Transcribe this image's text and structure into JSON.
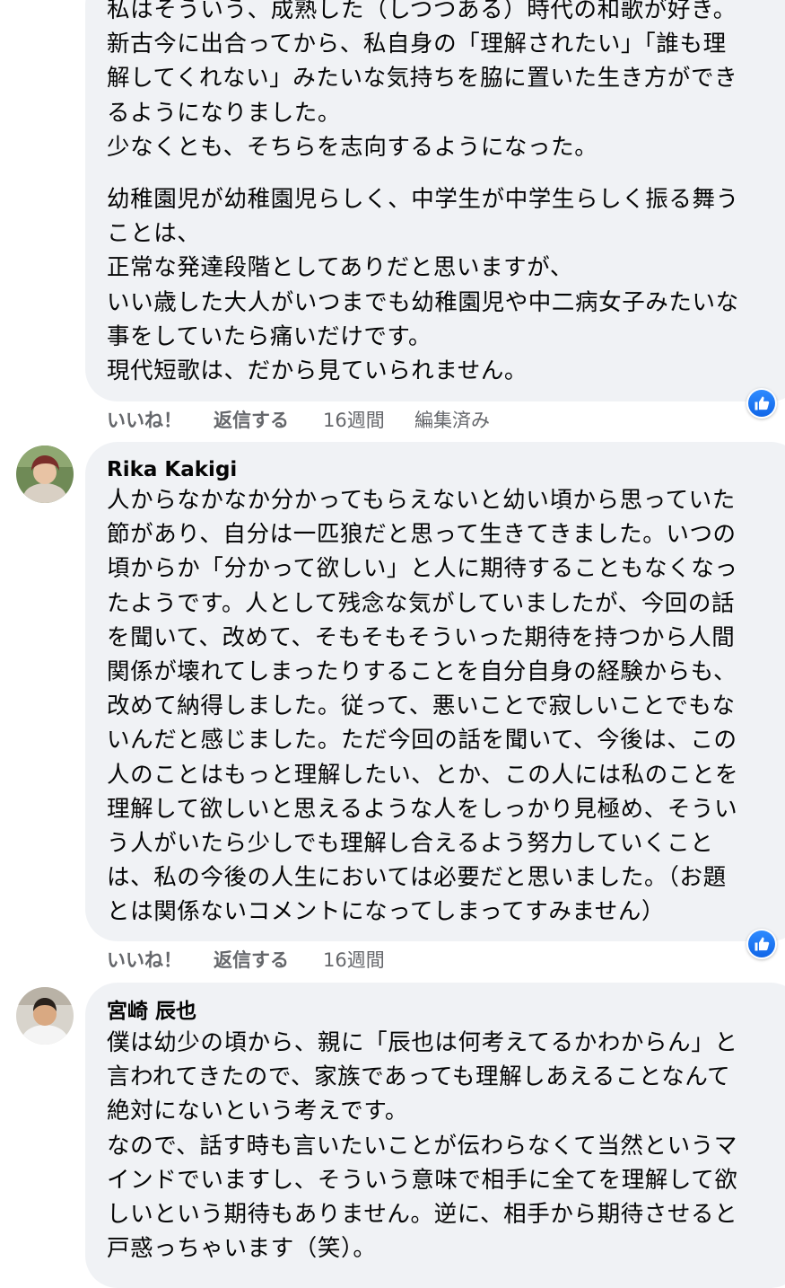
{
  "comment1": {
    "lines_a": [
      "私はそういう、成熟した（しつつある）時代の和歌が好き。",
      "新古今に出合ってから、私自身の「理解されたい」「誰も理",
      "解してくれない」みたいな気持ちを脇に置いた生き方ができ",
      "るようになりました。",
      "少なくとも、そちらを志向するようになった。"
    ],
    "lines_b": [
      "幼稚園児が幼稚園児らしく、中学生が中学生らしく振る舞う",
      "ことは、",
      "正常な発達段階としてありだと思いますが、",
      "いい歳した大人がいつまでも幼稚園児や中二病女子みたいな",
      "事をしていたら痛いだけです。",
      "現代短歌は、だから見ていられません。"
    ],
    "like_label": "いいね！",
    "reply_label": "返信する",
    "time": "16週間",
    "edited": "編集済み"
  },
  "comment2": {
    "author": "Rika Kakigi",
    "lines": [
      "人からなかなか分かってもらえないと幼い頃から思っていた",
      "節があり、自分は一匹狼だと思って生きてきました。いつの",
      "頃からか「分かって欲しい」と人に期待することもなくなっ",
      "たようです。人として残念な気がしていましたが、今回の話",
      "を聞いて、改めて、そもそもそういった期待を持つから人間",
      "関係が壊れてしまったりすることを自分自身の経験からも、",
      "改めて納得しました。従って、悪いことで寂しいことでもな",
      "いんだと感じました。ただ今回の話を聞いて、今後は、この",
      "人のことはもっと理解したい、とか、この人には私のことを",
      "理解して欲しいと思えるような人をしっかり見極め、そうい",
      "う人がいたら少しでも理解し合えるよう努力していくこと",
      "は、私の今後の人生においては必要だと思いました。（お題",
      "とは関係ないコメントになってしまってすみません）"
    ],
    "like_label": "いいね！",
    "reply_label": "返信する",
    "time": "16週間"
  },
  "comment3": {
    "author": "宮崎 辰也",
    "lines": [
      "僕は幼少の頃から、親に「辰也は何考えてるかわからん」と",
      "言われてきたので、家族であっても理解しあえることなんて",
      "絶対にないという考えです。",
      "なので、話す時も言いたいことが伝わらなくて当然というマ",
      "インドでいますし、そういう意味で相手に全てを理解して欲",
      "しいという期待もありません。逆に、相手から期待させると",
      "戸惑っちゃいます（笑）。"
    ]
  },
  "icons": {
    "reaction": "like-thumbs-up-icon",
    "accent": "#1877f2"
  }
}
